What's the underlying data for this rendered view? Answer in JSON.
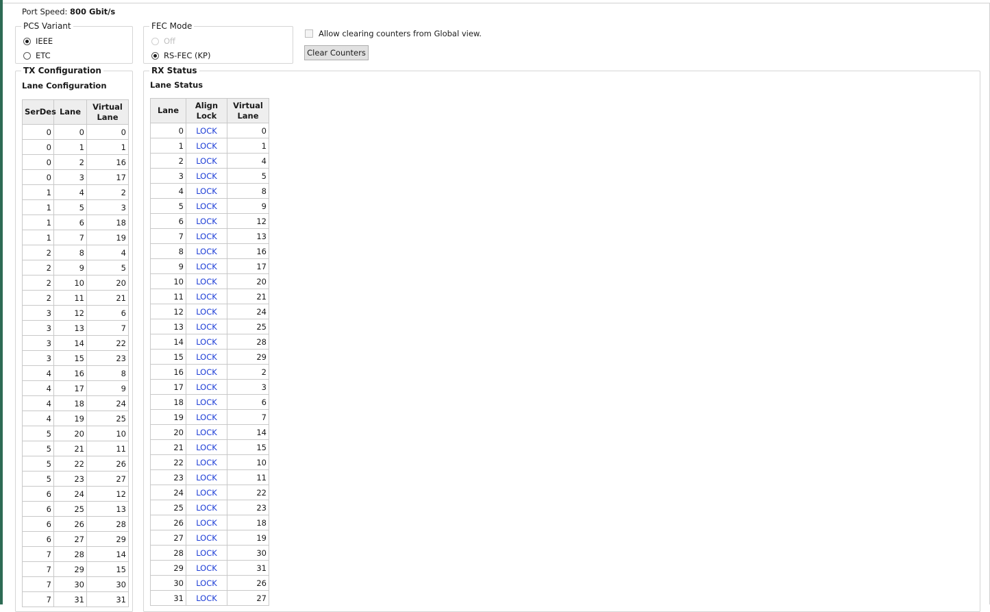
{
  "port_speed": {
    "label": "Port Speed:",
    "value": "800 Gbit/s"
  },
  "pcs_variant": {
    "title": "PCS Variant",
    "options": [
      {
        "label": "IEEE",
        "checked": true
      },
      {
        "label": "ETC",
        "checked": false
      }
    ]
  },
  "fec_mode": {
    "title": "FEC Mode",
    "options": [
      {
        "label": "Off",
        "checked": false,
        "disabled": true
      },
      {
        "label": "RS-FEC (KP)",
        "checked": true,
        "disabled": false
      }
    ]
  },
  "allow_clear": {
    "label": "Allow clearing counters from Global view.",
    "checked": false
  },
  "clear_counters": {
    "label": "Clear Counters"
  },
  "tx": {
    "title": "TX Configuration",
    "subtitle": "Lane Configuration",
    "headers": [
      "SerDes",
      "Lane",
      "Virtual Lane"
    ],
    "rows": [
      [
        0,
        0,
        0
      ],
      [
        0,
        1,
        1
      ],
      [
        0,
        2,
        16
      ],
      [
        0,
        3,
        17
      ],
      [
        1,
        4,
        2
      ],
      [
        1,
        5,
        3
      ],
      [
        1,
        6,
        18
      ],
      [
        1,
        7,
        19
      ],
      [
        2,
        8,
        4
      ],
      [
        2,
        9,
        5
      ],
      [
        2,
        10,
        20
      ],
      [
        2,
        11,
        21
      ],
      [
        3,
        12,
        6
      ],
      [
        3,
        13,
        7
      ],
      [
        3,
        14,
        22
      ],
      [
        3,
        15,
        23
      ],
      [
        4,
        16,
        8
      ],
      [
        4,
        17,
        9
      ],
      [
        4,
        18,
        24
      ],
      [
        4,
        19,
        25
      ],
      [
        5,
        20,
        10
      ],
      [
        5,
        21,
        11
      ],
      [
        5,
        22,
        26
      ],
      [
        5,
        23,
        27
      ],
      [
        6,
        24,
        12
      ],
      [
        6,
        25,
        13
      ],
      [
        6,
        26,
        28
      ],
      [
        6,
        27,
        29
      ],
      [
        7,
        28,
        14
      ],
      [
        7,
        29,
        15
      ],
      [
        7,
        30,
        30
      ],
      [
        7,
        31,
        31
      ]
    ]
  },
  "rx": {
    "title": "RX Status",
    "subtitle": "Lane Status",
    "headers": [
      "Lane",
      "Align Lock",
      "Virtual Lane"
    ],
    "rows": [
      [
        0,
        "LOCK",
        0
      ],
      [
        1,
        "LOCK",
        1
      ],
      [
        2,
        "LOCK",
        4
      ],
      [
        3,
        "LOCK",
        5
      ],
      [
        4,
        "LOCK",
        8
      ],
      [
        5,
        "LOCK",
        9
      ],
      [
        6,
        "LOCK",
        12
      ],
      [
        7,
        "LOCK",
        13
      ],
      [
        8,
        "LOCK",
        16
      ],
      [
        9,
        "LOCK",
        17
      ],
      [
        10,
        "LOCK",
        20
      ],
      [
        11,
        "LOCK",
        21
      ],
      [
        12,
        "LOCK",
        24
      ],
      [
        13,
        "LOCK",
        25
      ],
      [
        14,
        "LOCK",
        28
      ],
      [
        15,
        "LOCK",
        29
      ],
      [
        16,
        "LOCK",
        2
      ],
      [
        17,
        "LOCK",
        3
      ],
      [
        18,
        "LOCK",
        6
      ],
      [
        19,
        "LOCK",
        7
      ],
      [
        20,
        "LOCK",
        14
      ],
      [
        21,
        "LOCK",
        15
      ],
      [
        22,
        "LOCK",
        10
      ],
      [
        23,
        "LOCK",
        11
      ],
      [
        24,
        "LOCK",
        22
      ],
      [
        25,
        "LOCK",
        23
      ],
      [
        26,
        "LOCK",
        18
      ],
      [
        27,
        "LOCK",
        19
      ],
      [
        28,
        "LOCK",
        30
      ],
      [
        29,
        "LOCK",
        31
      ],
      [
        30,
        "LOCK",
        26
      ],
      [
        31,
        "LOCK",
        27
      ]
    ]
  },
  "colors": {
    "lock_text": "#1b3cd6",
    "accent_bar": "#2e6b55",
    "header_bg": "#eeeeee"
  }
}
